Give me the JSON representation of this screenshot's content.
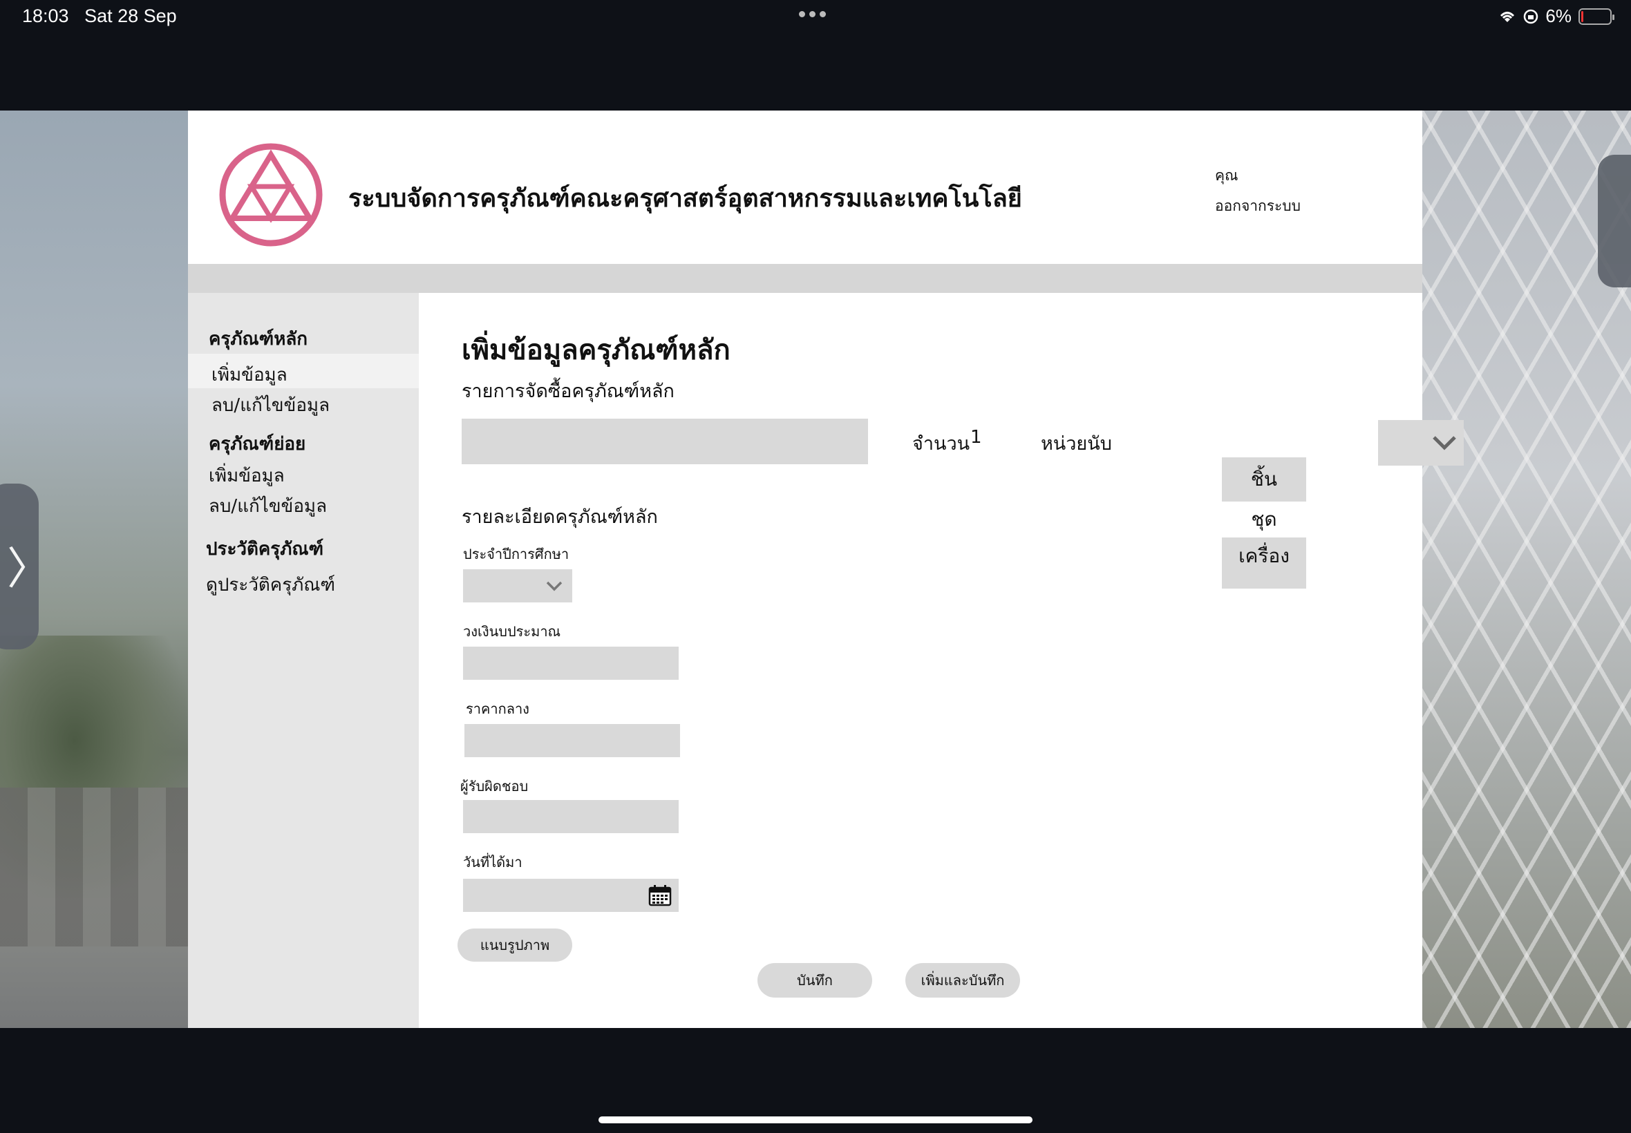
{
  "status_bar": {
    "time": "18:03",
    "date": "Sat 28 Sep",
    "battery": "6%"
  },
  "header": {
    "title": "ระบบจัดการครุภัณฑ์คณะครุศาสตร์อุตสาหกรรมและเทคโนโลยี",
    "user_label": "คุณ",
    "logout": "ออกจากระบบ"
  },
  "sidebar": {
    "sections": [
      {
        "heading": "ครุภัณฑ์หลัก",
        "items": [
          "เพิ่มข้อมูล",
          "ลบ/แก้ไขข้อมูล"
        ]
      },
      {
        "heading": "ครุภัณฑ์ย่อย",
        "items": [
          "เพิ่มข้อมูล",
          "ลบ/แก้ไขข้อมูล"
        ]
      },
      {
        "heading": "ประวัติครุภัณฑ์",
        "items": [
          "ดูประวัติครุภัณฑ์"
        ]
      }
    ]
  },
  "form": {
    "page_title": "เพิ่มข้อมูลครุภัณฑ์หลัก",
    "purchase_label": "รายการจัดซื้อครุภัณฑ์หลัก",
    "purchase_value": "",
    "quantity_label": "จำนวน",
    "quantity_value": "1",
    "unit_label": "หน่วยนับ",
    "unit_options": [
      "ชิ้น",
      "ชุด",
      "เครื่อง"
    ],
    "details_label": "รายละเอียดครุภัณฑ์หลัก",
    "year_label": "ประจำปีการศึกษา",
    "budget_label": "วงเงินบประมาณ",
    "budget_value": "",
    "median_price_label": "ราคากลาง",
    "median_price_value": "",
    "responsible_label": "ผู้รับผิดชอบ",
    "responsible_value": "",
    "date_label": "วันที่ได้มา",
    "date_value": "",
    "attach_button": "แนบรูปภาพ",
    "save_button": "บันทึก",
    "add_save_button": "เพิ่มและบันทึก"
  },
  "colors": {
    "logo": "#d9638a",
    "field_bg": "#d9d9d9",
    "sidebar_bg": "#e6e6e6"
  }
}
